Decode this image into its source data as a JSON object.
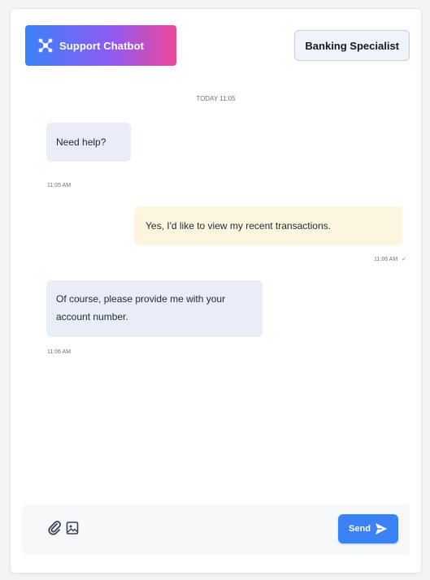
{
  "header": {
    "brand_label": "Support Chatbot",
    "specialist_label": "Banking Specialist"
  },
  "chat": {
    "date_separator": "TODAY 11:05",
    "messages": [
      {
        "side": "in",
        "text": "Need help?",
        "time": "11:05 AM"
      },
      {
        "side": "out",
        "text": "Yes, I'd like to view my recent transactions.",
        "time": "11:06 AM",
        "status": "✓"
      },
      {
        "side": "in",
        "text": "Of course, please provide me with your account number.",
        "time": "11:06 AM"
      }
    ]
  },
  "composer": {
    "attach_icon": "paperclip-icon",
    "image_icon": "image-icon",
    "send_label": "Send",
    "send_icon": "send-icon"
  },
  "colors": {
    "accent": "#3b82f6",
    "brand_gradient_start": "#3b82f6",
    "brand_gradient_end": "#ec4899",
    "incoming_bubble": "#e8edf8",
    "outgoing_bubble": "#fdf6de"
  }
}
